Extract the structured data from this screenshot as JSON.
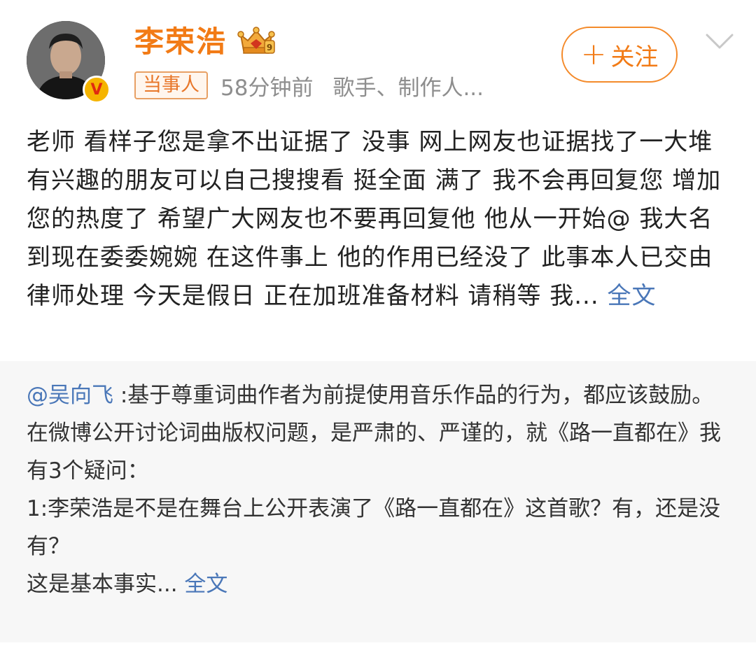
{
  "header": {
    "username": "李荣浩",
    "vip_badge_icon": "crown-vip-badge-icon",
    "verified_icon": "verified-v-icon",
    "party_tag": "当事人",
    "time": "58分钟前",
    "description": "歌手、制作人...",
    "follow_label": "关注",
    "follow_plus": "+",
    "menu_icon": "chevron-down-icon"
  },
  "post": {
    "text": "老师 看样子您是拿不出证据了 没事 网上网友也证据找了一大堆 有兴趣的朋友可以自己搜搜看 挺全面 满了  我不会再回复您 增加您的热度了 希望广大网友也不要再回复他 他从一开始@ 我大名 到现在委委婉婉 在这件事上 他的作用已经没了  此事本人已交由律师处理 今天是假日 正在加班准备材料 请稍等   我...",
    "more_label": "全文"
  },
  "repost": {
    "mention": "@吴向飞",
    "line1": " :基于尊重词曲作者为前提使用音乐作品的行为，都应该鼓励。",
    "line2": "在微博公开讨论词曲版权问题，是严肃的、严谨的，就《路一直都在》我有3个疑问：",
    "line3": "1:李荣浩是不是在舞台上公开表演了《路一直都在》这首歌？有，还是没有？",
    "line4": "这是基本事实...",
    "more_label": "全文"
  },
  "colors": {
    "username": "#f27b16",
    "link": "#4a77b8",
    "repost_bg": "#f7f7f7",
    "muted": "#8e8e8e"
  }
}
